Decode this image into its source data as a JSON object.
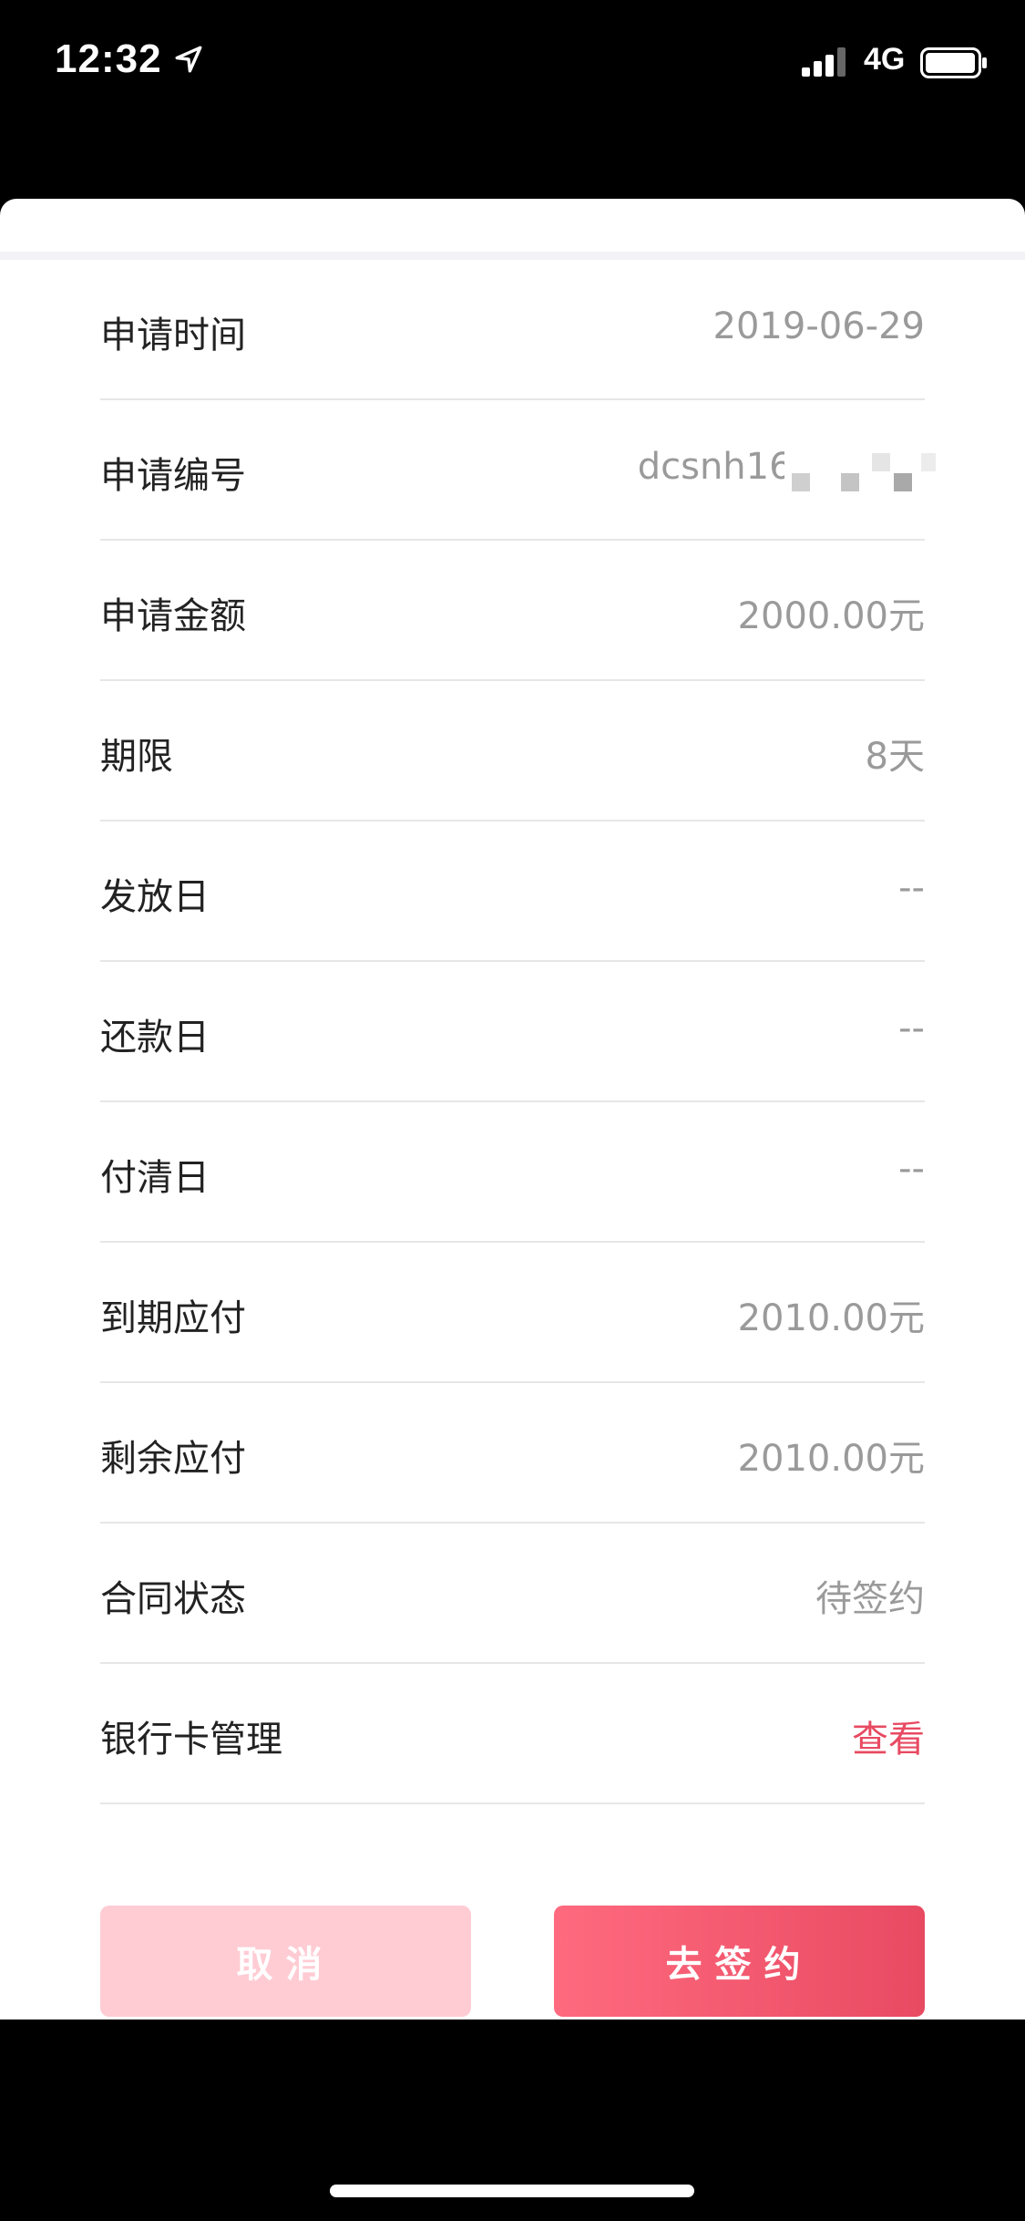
{
  "status_bar": {
    "time": "12:32",
    "network": "4G",
    "icons": [
      "location-icon",
      "signal-icon",
      "battery-icon"
    ]
  },
  "details": {
    "rows": [
      {
        "label": "申请时间",
        "value": "2019-06-29"
      },
      {
        "label": "申请编号",
        "value": "dcsnh163"
      },
      {
        "label": "申请金额",
        "value": "2000.00元"
      },
      {
        "label": "期限",
        "value": "8天"
      },
      {
        "label": "发放日",
        "value": "--"
      },
      {
        "label": "还款日",
        "value": "--"
      },
      {
        "label": "付清日",
        "value": "--"
      },
      {
        "label": "到期应付",
        "value": "2010.00元"
      },
      {
        "label": "剩余应付",
        "value": "2010.00元"
      },
      {
        "label": "合同状态",
        "value": "待签约"
      },
      {
        "label": "银行卡管理",
        "value": "查看"
      }
    ]
  },
  "actions": {
    "cancel_label": "取消",
    "sign_label": "去签约"
  },
  "colors": {
    "accent": "#e84a62",
    "cancel_bg": "#ffccd4",
    "value_text": "#9a9a9a"
  }
}
